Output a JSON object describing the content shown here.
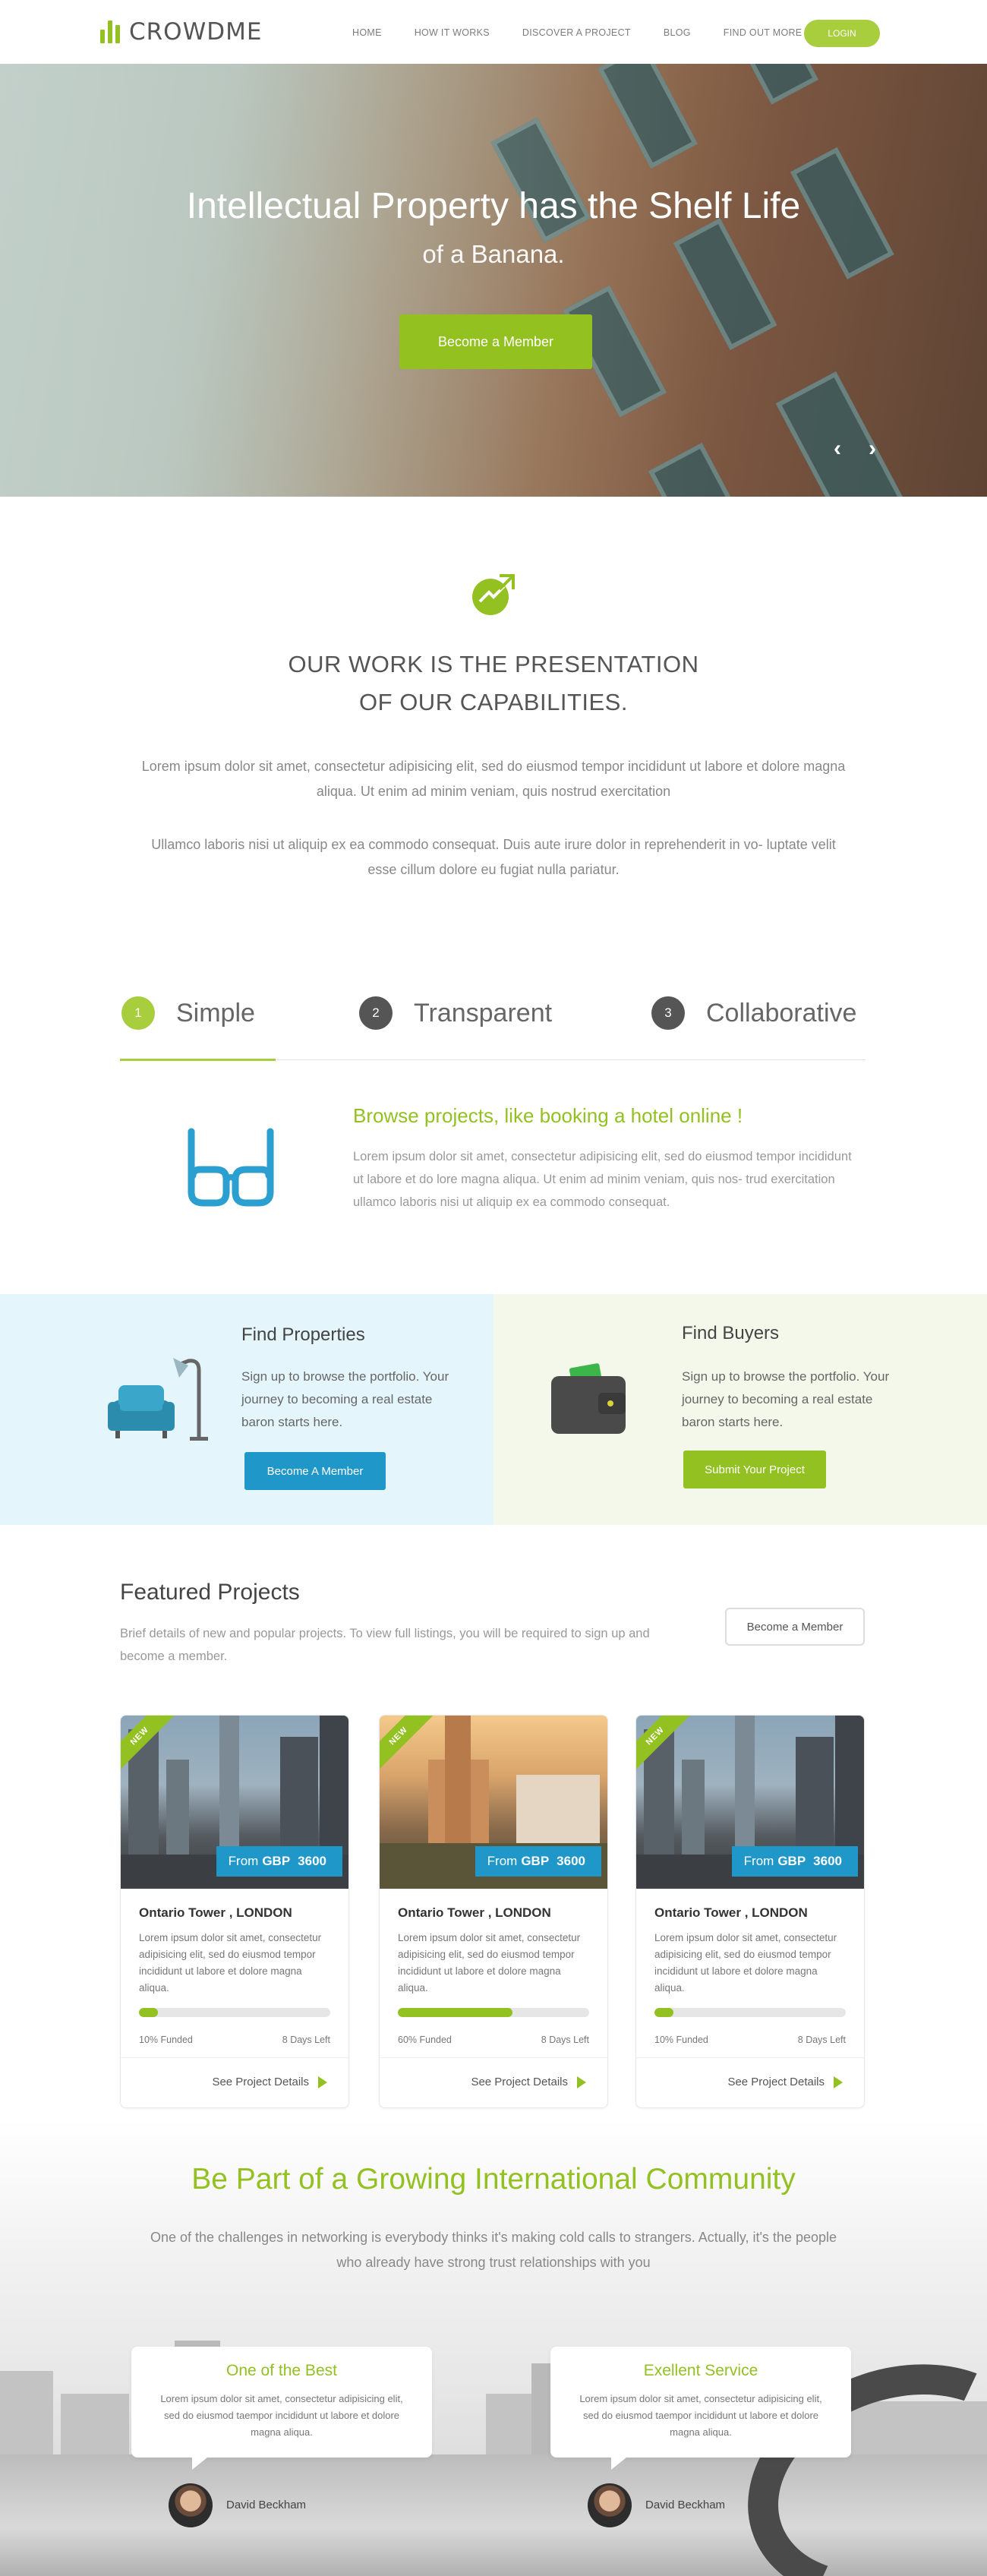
{
  "header": {
    "logo_text": "CROWDME",
    "nav": [
      "HOME",
      "HOW IT WORKS",
      "DISCOVER A PROJECT",
      "BLOG",
      "FIND OUT MORE"
    ],
    "login_label": "LOGIN"
  },
  "hero": {
    "title": "Intellectual Property has the Shelf Life",
    "subtitle": "of a Banana.",
    "button": "Become a Member",
    "prev_icon": "chevron-left-icon",
    "next_icon": "chevron-right-icon"
  },
  "ourwork": {
    "icon": "growth-chart-icon",
    "title_line1": "OUR WORK IS THE PRESENTATION",
    "title_line2": "OF OUR CAPABILITIES.",
    "para1": "Lorem ipsum dolor sit amet, consectetur adipisicing elit, sed do eiusmod tempor incididunt ut labore et dolore magna aliqua. Ut enim ad minim veniam, quis nostrud exercitation",
    "para2": "Ullamco laboris nisi ut aliquip ex ea commodo consequat. Duis aute irure dolor in reprehenderit in vo- luptate velit esse cillum dolore eu fugiat nulla pariatur."
  },
  "steps": [
    {
      "num": "1",
      "label": "Simple",
      "color": "#a8cd3d"
    },
    {
      "num": "2",
      "label": "Transparent",
      "color": "#555555"
    },
    {
      "num": "3",
      "label": "Collaborative",
      "color": "#555555"
    }
  ],
  "browse": {
    "icon": "glasses-icon",
    "title": "Browse projects, like booking a hotel online !",
    "text": "Lorem ipsum dolor sit amet, consectetur adipisicing elit, sed do eiusmod tempor incididunt ut labore et do lore magna aliqua. Ut enim ad minim veniam, quis nos- trud exercitation ullamco laboris nisi ut aliquip ex ea commodo consequat."
  },
  "find": {
    "properties": {
      "icon": "armchair-lamp-icon",
      "title": "Find Properties",
      "text": "Sign up to browse the portfolio. Your journey to becoming a real estate baron starts here.",
      "button": "Become A Member",
      "button_color": "#1f97c9"
    },
    "buyers": {
      "icon": "wallet-icon",
      "title": "Find Buyers",
      "text": "Sign up to browse the portfolio. Your journey to becoming a real estate baron starts here.",
      "button": "Submit Your Project",
      "button_color": "#93c121"
    }
  },
  "featured": {
    "title": "Featured Projects",
    "desc": "Brief details of new and popular projects. To view full listings, you will be required to sign up and become a member.",
    "button": "Become a Member",
    "cards": [
      {
        "ribbon": "NEW",
        "price_prefix": "From",
        "currency": "GBP",
        "price": "3600",
        "title": "Ontario Tower , LONDON",
        "text": "Lorem ipsum dolor sit amet, consectetur adipisicing elit, sed do eiusmod tempor incididunt ut labore et dolore magna aliqua.",
        "funded_pct": 0.1,
        "funded": "10% Funded",
        "days": "8 Days Left",
        "details": "See Project Details"
      },
      {
        "ribbon": "NEW",
        "price_prefix": "From",
        "currency": "GBP",
        "price": "3600",
        "title": "Ontario Tower , LONDON",
        "text": "Lorem ipsum dolor sit amet, consectetur adipisicing elit, sed do eiusmod tempor incididunt ut labore et dolore magna aliqua.",
        "funded_pct": 0.6,
        "funded": "60% Funded",
        "days": "8 Days Left",
        "details": "See Project Details"
      },
      {
        "ribbon": "NEW",
        "price_prefix": "From",
        "currency": "GBP",
        "price": "3600",
        "title": "Ontario Tower , LONDON",
        "text": "Lorem ipsum dolor sit amet, consectetur adipisicing elit, sed do eiusmod tempor incididunt ut labore et dolore magna aliqua.",
        "funded_pct": 0.1,
        "funded": "10% Funded",
        "days": "8 Days Left",
        "details": "See Project Details"
      }
    ]
  },
  "community": {
    "title": "Be Part of a Growing International Community",
    "text": "One of the challenges in networking is everybody thinks it's making cold calls to strangers. Actually, it's the people who already have strong trust relationships with you",
    "testimonials": [
      {
        "title": "One of the Best",
        "text": "Lorem ipsum dolor sit amet, consectetur adipisicing elit, sed do eiusmod taempor incididunt ut labore et dolore magna aliqua.",
        "name": "David Beckham"
      },
      {
        "title": "Exellent Service",
        "text": "Lorem ipsum dolor sit amet, consectetur adipisicing elit, sed do eiusmod taempor incididunt ut labore et dolore magna aliqua.",
        "name": "David Beckham"
      }
    ]
  }
}
